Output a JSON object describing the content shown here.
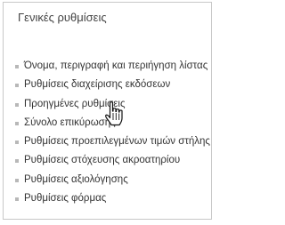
{
  "section": {
    "title": "Γενικές ρυθμίσεις",
    "links": [
      {
        "label": "Όνομα, περιγραφή και περιήγηση λίστας"
      },
      {
        "label": "Ρυθμίσεις διαχείρισης εκδόσεων"
      },
      {
        "label": "Προηγμένες ρυθμίσεις"
      },
      {
        "label": "Σύνολο επικύρωσης"
      },
      {
        "label": "Ρυθμίσεις προεπιλεγμένων τιμών στήλης"
      },
      {
        "label": "Ρυθμίσεις στόχευσης ακροατηρίου"
      },
      {
        "label": "Ρυθμίσεις αξιολόγησης"
      },
      {
        "label": "Ρυθμίσεις φόρμας"
      }
    ]
  },
  "cursor": {
    "icon": "hand-pointer-icon"
  }
}
